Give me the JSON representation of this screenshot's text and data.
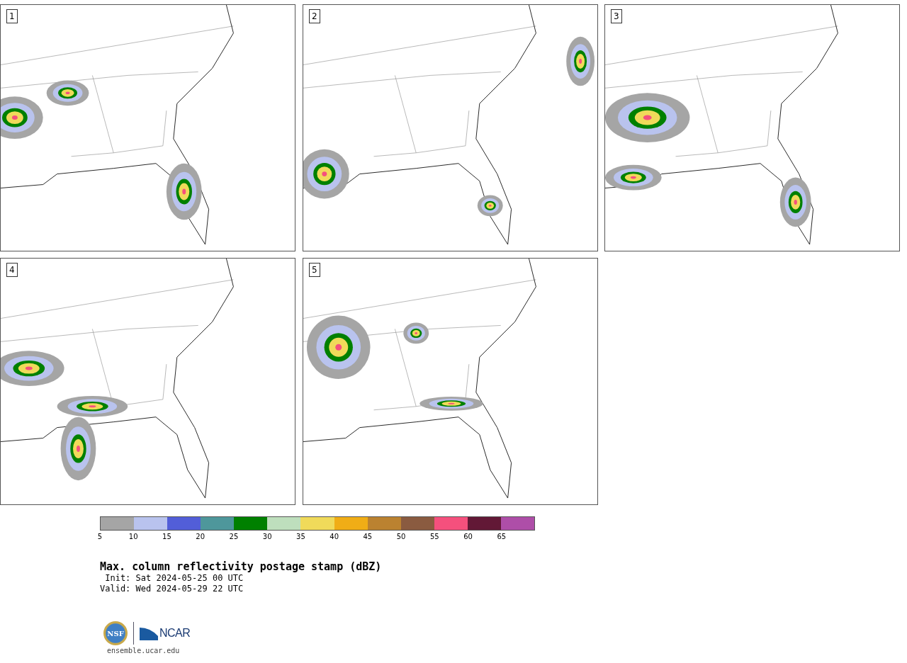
{
  "panels": [
    {
      "number": "1"
    },
    {
      "number": "2"
    },
    {
      "number": "3"
    },
    {
      "number": "4"
    },
    {
      "number": "5"
    }
  ],
  "legend": {
    "bins": [
      {
        "label": "5",
        "color": "#a5a5a5"
      },
      {
        "label": "10",
        "color": "#b9c3ee"
      },
      {
        "label": "15",
        "color": "#525ed8"
      },
      {
        "label": "20",
        "color": "#4e979b"
      },
      {
        "label": "25",
        "color": "#008000"
      },
      {
        "label": "30",
        "color": "#bedfbd"
      },
      {
        "label": "35",
        "color": "#f0da5a"
      },
      {
        "label": "40",
        "color": "#f0ad16"
      },
      {
        "label": "45",
        "color": "#bb8230"
      },
      {
        "label": "50",
        "color": "#8a5b40"
      },
      {
        "label": "55",
        "color": "#f5507d"
      },
      {
        "label": "60",
        "color": "#621836"
      },
      {
        "label": "65",
        "color": "#ae4ea8"
      }
    ]
  },
  "title": "Max. column reflectivity postage stamp (dBZ)",
  "init": " Init: Sat 2024-05-25 00 UTC",
  "valid": "Valid: Wed 2024-05-29 22 UTC",
  "logos": {
    "seal": "NSF",
    "wordmark": "NCAR"
  },
  "footer": "ensemble.ucar.edu"
}
